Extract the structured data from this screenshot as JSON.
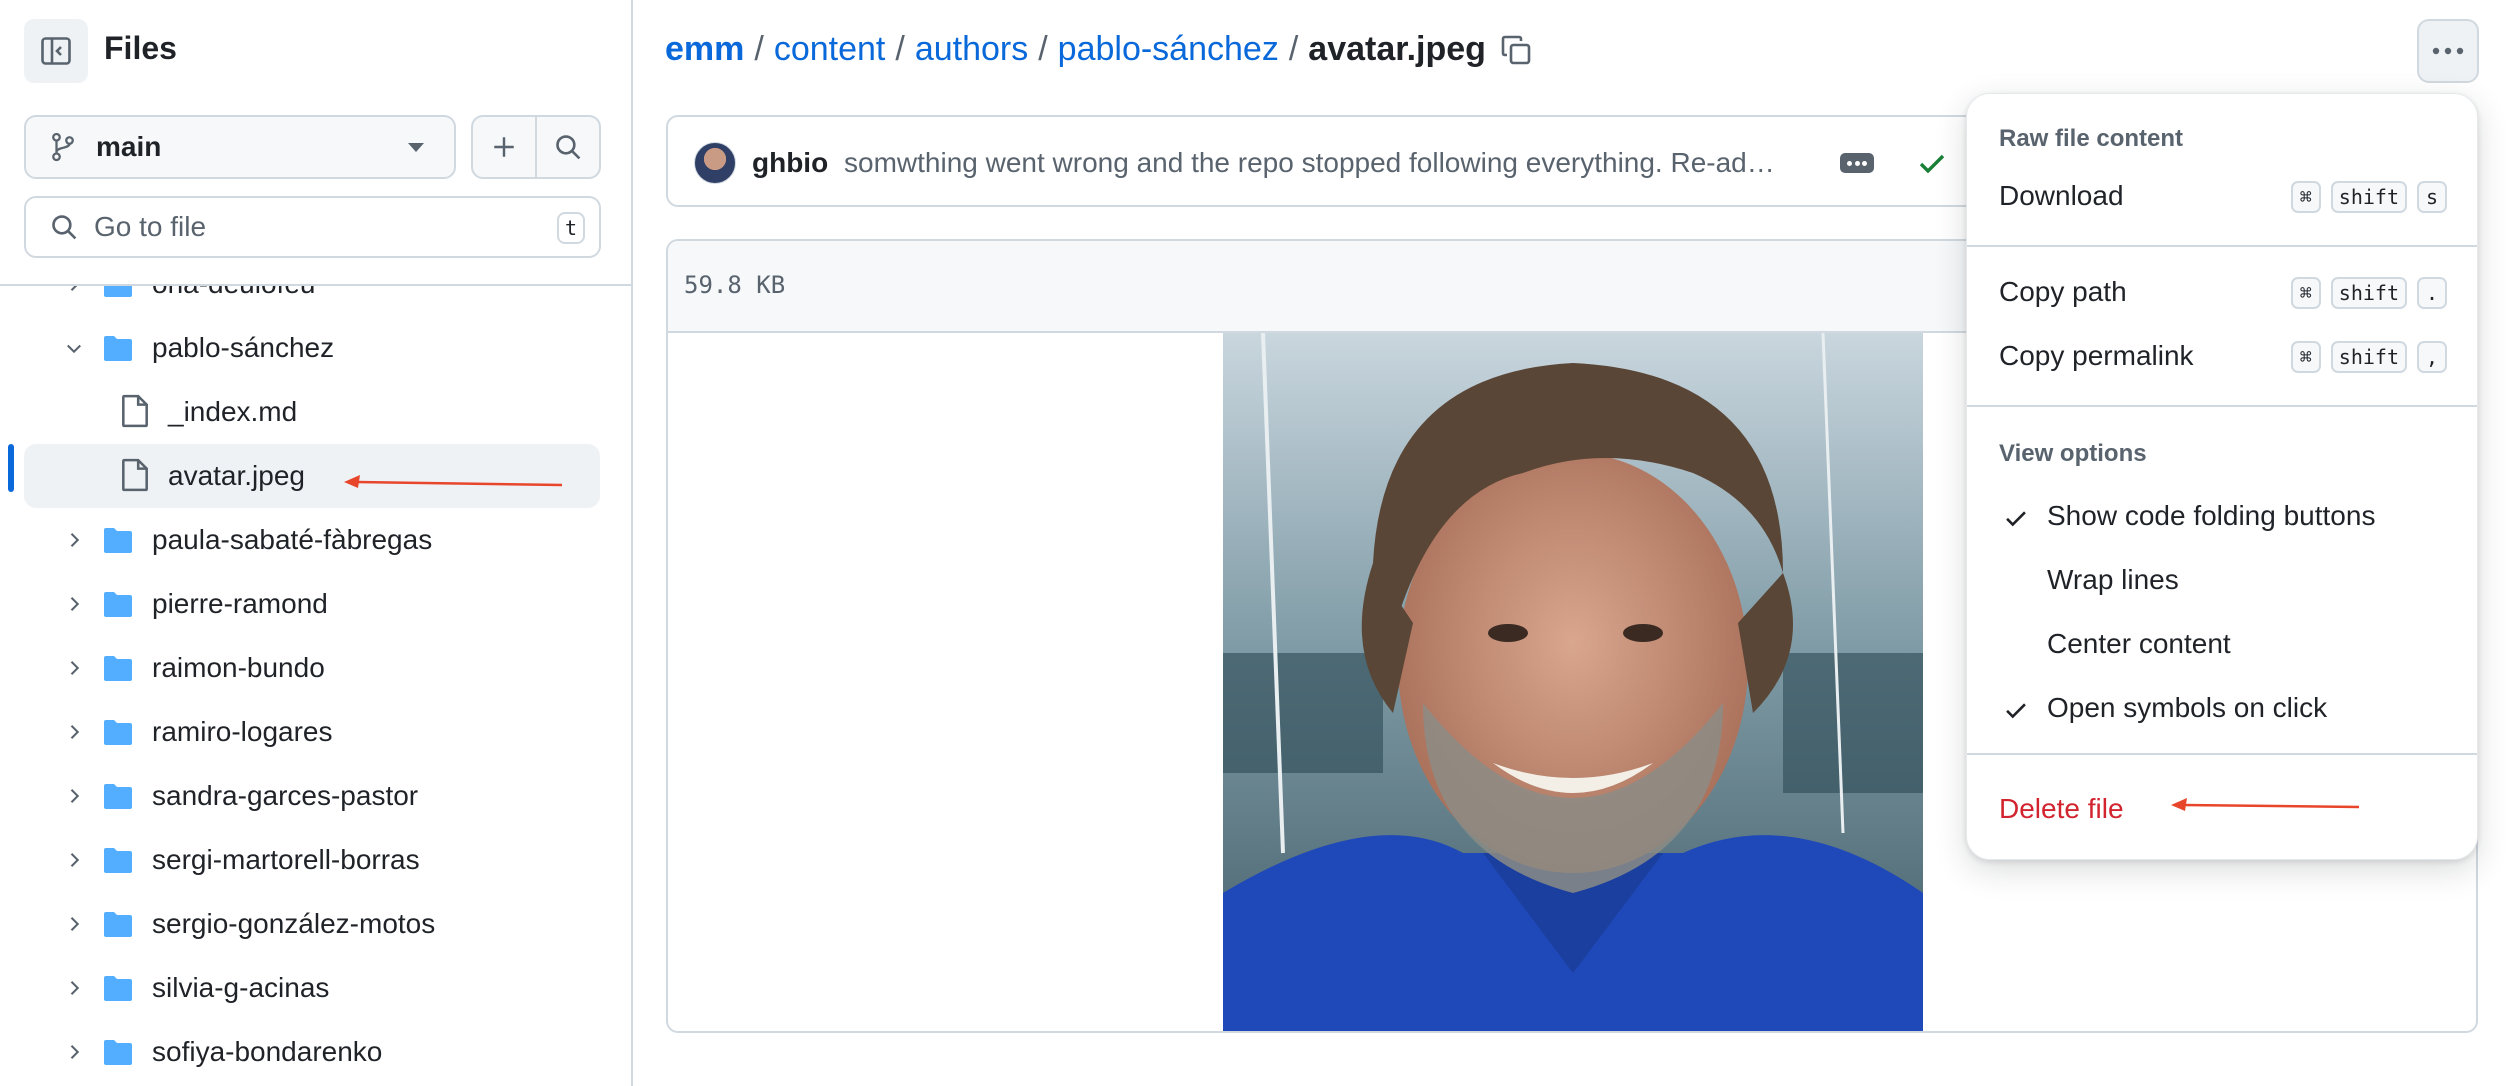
{
  "sidebar": {
    "title": "Files",
    "branch": "main",
    "search_placeholder": "Go to file",
    "search_shortcut": "t",
    "tree": [
      {
        "name": "ona-deulofeu",
        "type": "folder",
        "expanded": false
      },
      {
        "name": "pablo-sánchez",
        "type": "folder",
        "expanded": true
      },
      {
        "name": "_index.md",
        "type": "file"
      },
      {
        "name": "avatar.jpeg",
        "type": "file",
        "selected": true
      },
      {
        "name": "paula-sabaté-fàbregas",
        "type": "folder",
        "expanded": false
      },
      {
        "name": "pierre-ramond",
        "type": "folder",
        "expanded": false
      },
      {
        "name": "raimon-bundo",
        "type": "folder",
        "expanded": false
      },
      {
        "name": "ramiro-logares",
        "type": "folder",
        "expanded": false
      },
      {
        "name": "sandra-garces-pastor",
        "type": "folder",
        "expanded": false
      },
      {
        "name": "sergi-martorell-borras",
        "type": "folder",
        "expanded": false
      },
      {
        "name": "sergio-gonzález-motos",
        "type": "folder",
        "expanded": false
      },
      {
        "name": "silvia-g-acinas",
        "type": "folder",
        "expanded": false
      },
      {
        "name": "sofiya-bondarenko",
        "type": "folder",
        "expanded": false
      }
    ]
  },
  "breadcrumb": {
    "segments": [
      "emm",
      "content",
      "authors",
      "pablo-sánchez"
    ],
    "current": "avatar.jpeg",
    "separator": "/"
  },
  "commit": {
    "user": "ghbio",
    "message": "somwthing went wrong and the repo stopped following everything. Re-ad…"
  },
  "file": {
    "size": "59.8 KB"
  },
  "menu": {
    "raw_title": "Raw file content",
    "download": {
      "label": "Download",
      "keys": [
        "⌘",
        "shift",
        "s"
      ]
    },
    "copy_path": {
      "label": "Copy path",
      "keys": [
        "⌘",
        "shift",
        "."
      ]
    },
    "copy_permalink": {
      "label": "Copy permalink",
      "keys": [
        "⌘",
        "shift",
        ","
      ]
    },
    "view_title": "View options",
    "view_options": [
      {
        "label": "Show code folding buttons",
        "checked": true
      },
      {
        "label": "Wrap lines",
        "checked": false
      },
      {
        "label": "Center content",
        "checked": false
      },
      {
        "label": "Open symbols on click",
        "checked": true
      }
    ],
    "delete": "Delete file"
  },
  "colors": {
    "accent": "#0969da",
    "danger": "#d1242f",
    "folder": "#54aeff",
    "annotation_arrow": "#e8462b"
  }
}
